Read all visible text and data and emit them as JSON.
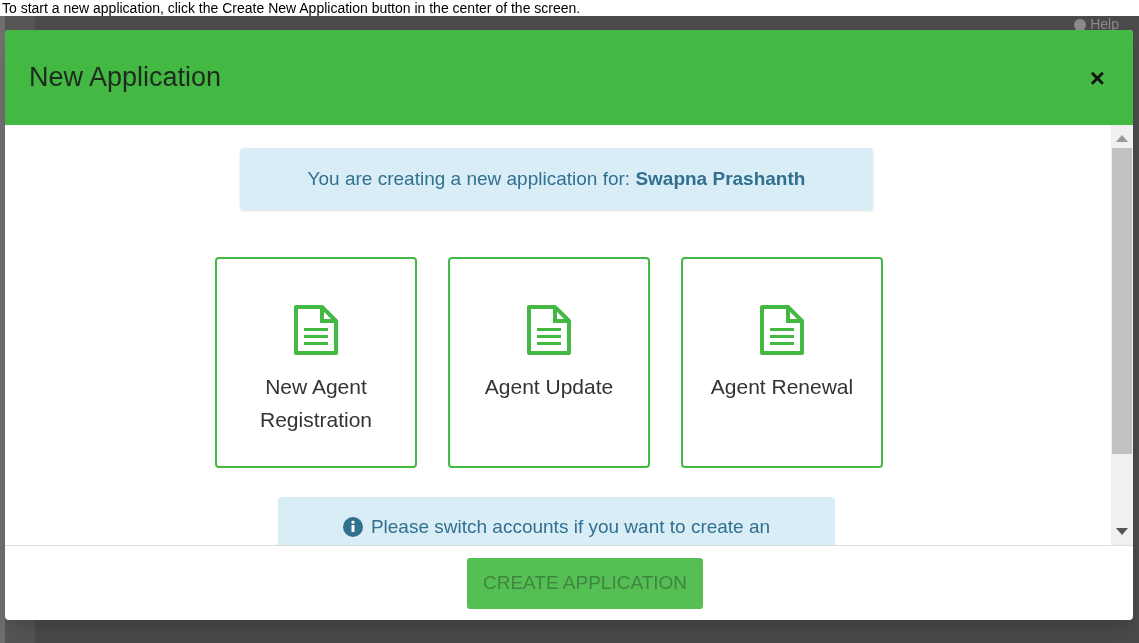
{
  "page": {
    "caption": "To start a new application, click the Create New Application button in the center of the screen.",
    "help": "Help"
  },
  "modal": {
    "title": "New Application",
    "close": "×",
    "notice": "You are creating a new application for: **Swapna Prashanth**",
    "options": [
      {
        "label": "New Agent Registration",
        "selected": false
      },
      {
        "label": "Agent Update",
        "selected": false
      },
      {
        "label": "Agent Renewal",
        "selected": false
      }
    ],
    "info": "Please switch accounts if you want to create an",
    "button": {
      "label": "CREATE APPLICATION",
      "disabled": true
    }
  }
}
